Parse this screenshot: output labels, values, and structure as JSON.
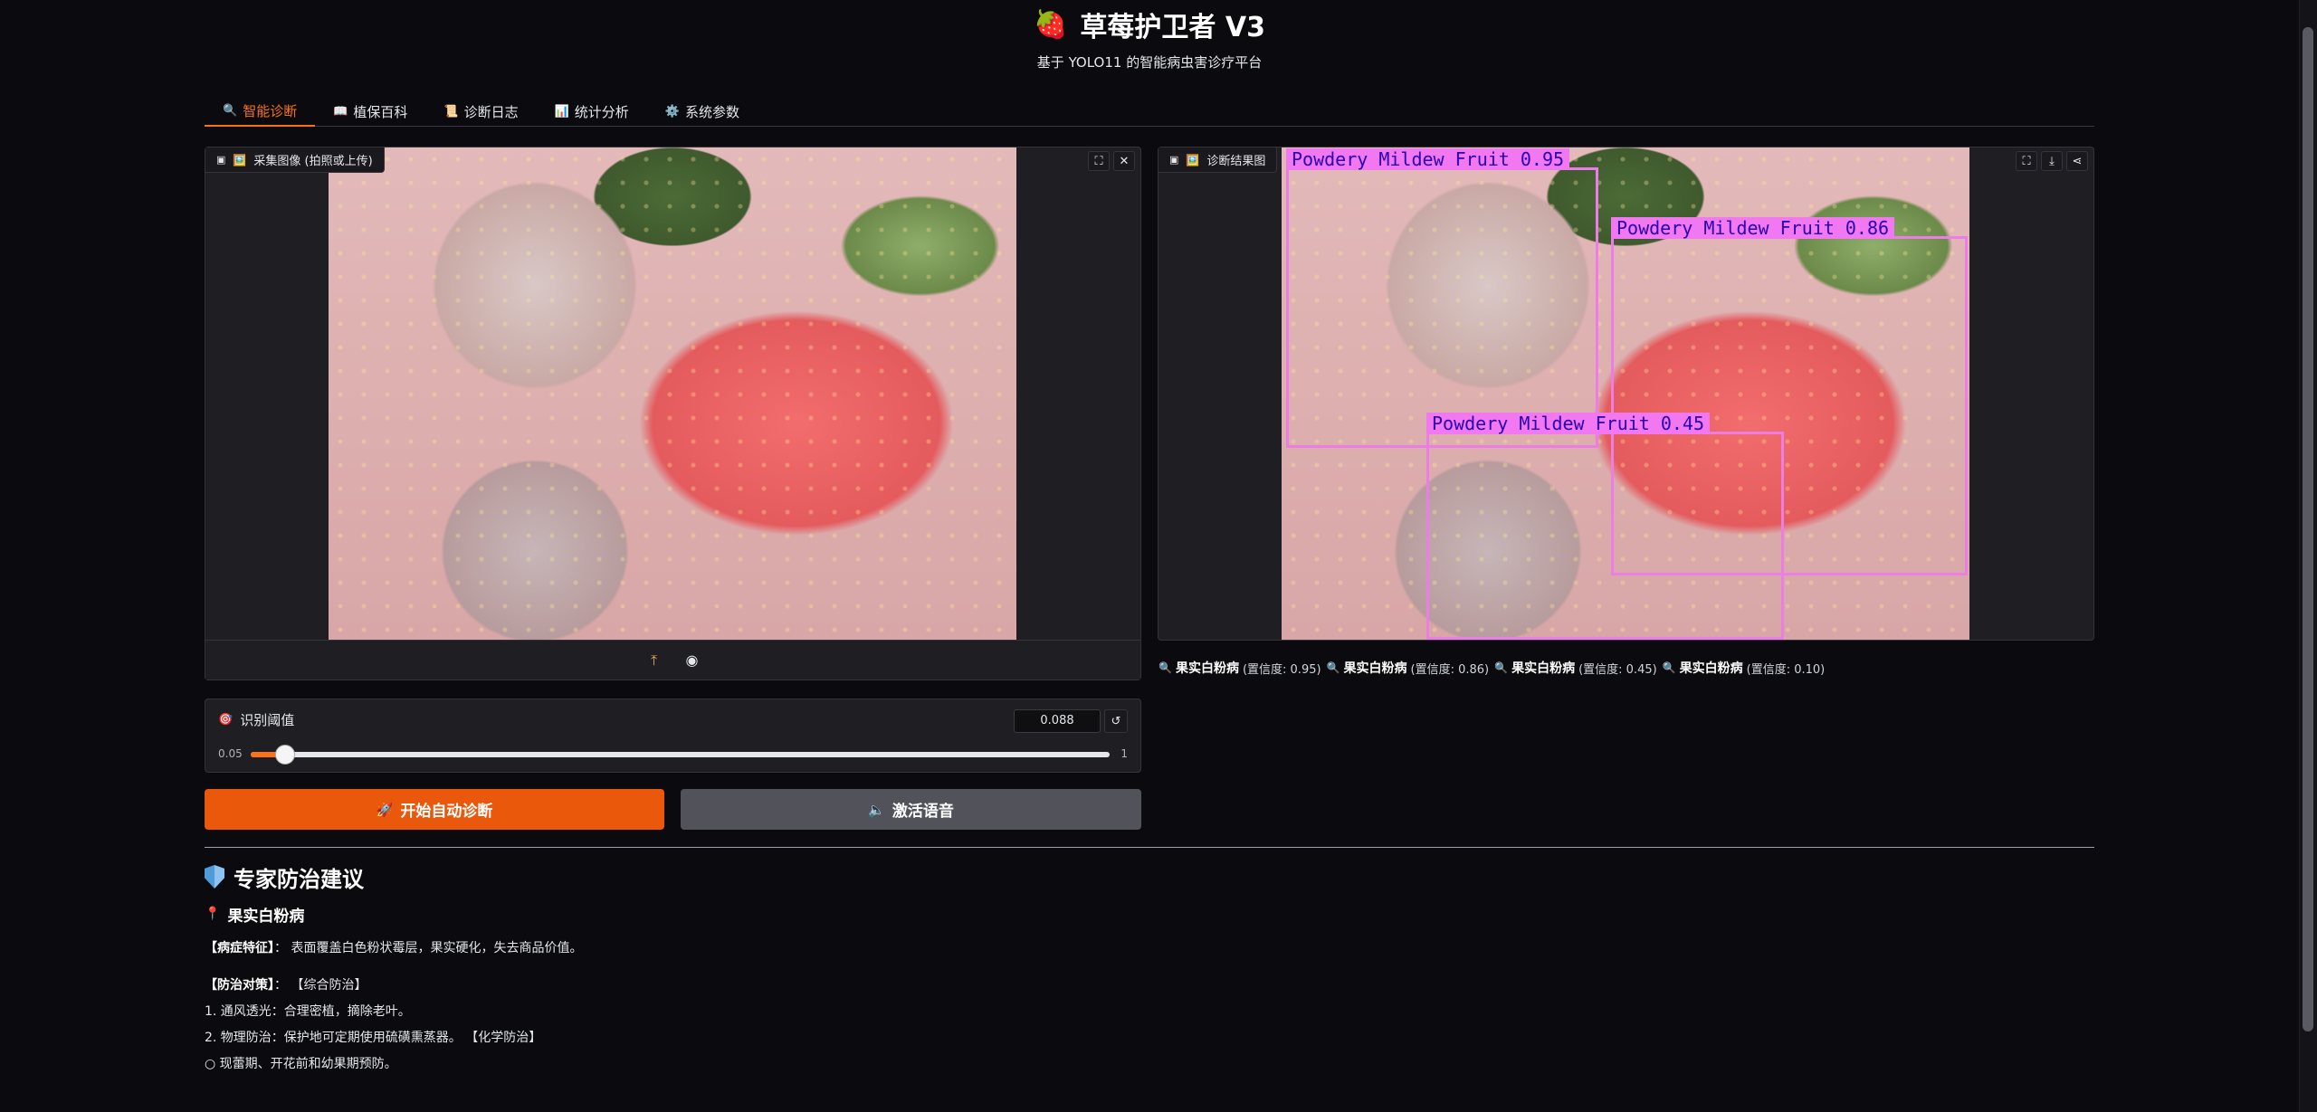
{
  "header": {
    "logo_icon": "🍓",
    "title": "草莓护卫者 V3",
    "subtitle": "基于 YOLO11 的智能病虫害诊疗平台"
  },
  "tabs": [
    {
      "icon": "🔍",
      "label": "智能诊断",
      "active": true
    },
    {
      "icon": "📖",
      "label": "植保百科",
      "active": false
    },
    {
      "icon": "📜",
      "label": "诊断日志",
      "active": false
    },
    {
      "icon": "📊",
      "label": "统计分析",
      "active": false
    },
    {
      "icon": "⚙️",
      "label": "系统参数",
      "active": false
    }
  ],
  "input_panel": {
    "label_icon": "🖼️",
    "label": "采集图像 (拍照或上传)",
    "actions": [
      "fullscreen-icon",
      "close-icon"
    ],
    "source_icons": [
      "upload-icon",
      "webcam-icon"
    ]
  },
  "output_panel": {
    "label_icon": "🖼️",
    "label": "诊断结果图",
    "actions": [
      "fullscreen-icon",
      "download-icon",
      "share-icon"
    ],
    "detections": [
      {
        "label": "Powdery Mildew Fruit 0.95"
      },
      {
        "label": "Powdery Mildew Fruit 0.86"
      },
      {
        "label": "Powdery Mildew Fruit 0.45"
      }
    ]
  },
  "results": [
    {
      "icon": "🔍",
      "name": "果实白粉病",
      "conf": "(置信度: 0.95)"
    },
    {
      "icon": "🔍",
      "name": "果实白粉病",
      "conf": "(置信度: 0.86)"
    },
    {
      "icon": "🔍",
      "name": "果实白粉病",
      "conf": "(置信度: 0.45)"
    },
    {
      "icon": "🔍",
      "name": "果实白粉病",
      "conf": "(置信度: 0.10)"
    }
  ],
  "threshold": {
    "icon": "🎯",
    "label": "识别阈值",
    "value": "0.088",
    "min": "0.05",
    "max": "1",
    "fraction": 0.04
  },
  "buttons": {
    "start_icon": "🚀",
    "start_label": "开始自动诊断",
    "voice_icon": "🔈",
    "voice_label": "激活语音"
  },
  "advice": {
    "title": "专家防治建议",
    "disease_icon": "📍",
    "disease": "果实白粉病",
    "symptom_title": "【病症特征】",
    "symptom_text": "： 表面覆盖白色粉状霉层，果实硬化，失去商品价值。",
    "control_title": "【防治对策】",
    "control_text": "： 【综合防治】",
    "line1": "1. 通风透光：合理密植，摘除老叶。",
    "line2": "2. 物理防治：保护地可定期使用硫磺熏蒸器。 【化学防治】",
    "line3": "○   现蕾期、开花前和幼果期预防。"
  },
  "colors": {
    "accent": "#f97316",
    "primary_button": "#ea580c",
    "secondary_button": "#52525b",
    "detection_box": "#ec7de6",
    "background": "#0b0b0f"
  }
}
